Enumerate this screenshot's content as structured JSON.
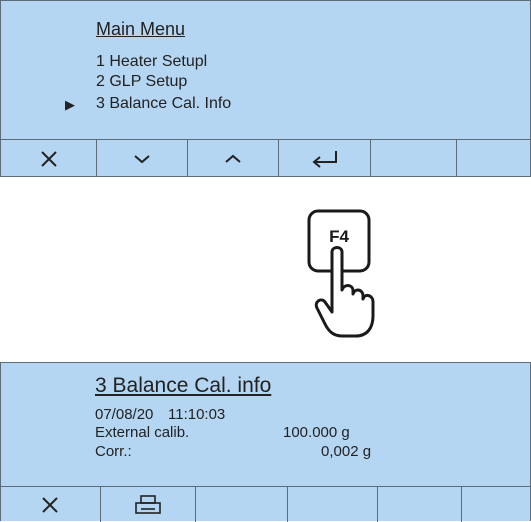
{
  "top_screen": {
    "title": "Main Menu",
    "items": [
      "1 Heater Setupl",
      "2 GLP Setup",
      "3 Balance Cal. Info"
    ],
    "selected_index": 2,
    "softkeys": [
      "close-icon",
      "chevron-down-icon",
      "chevron-up-icon",
      "enter-icon",
      "",
      ""
    ]
  },
  "key_press": {
    "label": "F4"
  },
  "bottom_screen": {
    "title": "3 Balance Cal. info",
    "date": "07/08/20",
    "time": "11:10:03",
    "external_calib_label": "External calib.",
    "external_calib_value": "100.000 g",
    "corr_label": "Corr.:",
    "corr_value": "0,002 g",
    "softkeys": [
      "close-icon",
      "printer-icon",
      "",
      "",
      "",
      ""
    ]
  },
  "colors": {
    "lcd_background": "#b5d6f2",
    "frame": "#5e6c78"
  }
}
